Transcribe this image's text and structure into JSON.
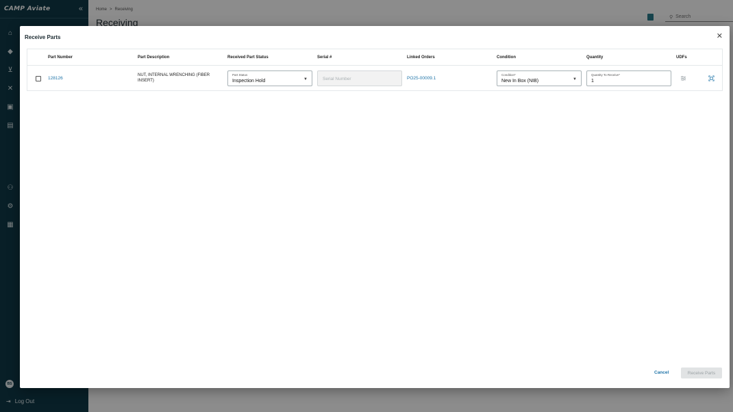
{
  "app": {
    "logo_text": "CAMP Aviate",
    "collapse_icon": "«"
  },
  "sidebar": {
    "icons": [
      "home-icon",
      "tag-icon",
      "cart-icon",
      "tools-icon",
      "inventory-icon",
      "warehouse-icon",
      "users-icon",
      "settings-icon",
      "document-icon"
    ],
    "avatar_initials": "BS",
    "logout_label": "Log Out"
  },
  "header": {
    "breadcrumb": [
      "Home",
      "Receiving"
    ],
    "title": "Receiving",
    "search_placeholder": "Search"
  },
  "modal": {
    "title": "Receive Parts",
    "columns": [
      "Part Number",
      "Part Description",
      "Received Part Status",
      "Serial #",
      "Linked Orders",
      "Condition",
      "Quantity",
      "UDFs"
    ],
    "row": {
      "part_number": "128126",
      "part_description_line1": "NUT, INTERNAL WRENCHING (FIBER",
      "part_description_line2": "INSERT)",
      "status_label": "Part Status",
      "status_value": "Inspection Hold",
      "serial_placeholder": "Serial Number",
      "linked_order": "PO25-00009.1",
      "condition_label": "Condition*",
      "condition_value": "New In Box (NIB)",
      "quantity_label": "Quantity To Receive*",
      "quantity_value": "1"
    },
    "cancel_label": "Cancel",
    "receive_label": "Receive Parts"
  },
  "colors": {
    "sidebar": "#0f3a48",
    "link": "#1f74a8",
    "accent": "#2b7c8c"
  }
}
